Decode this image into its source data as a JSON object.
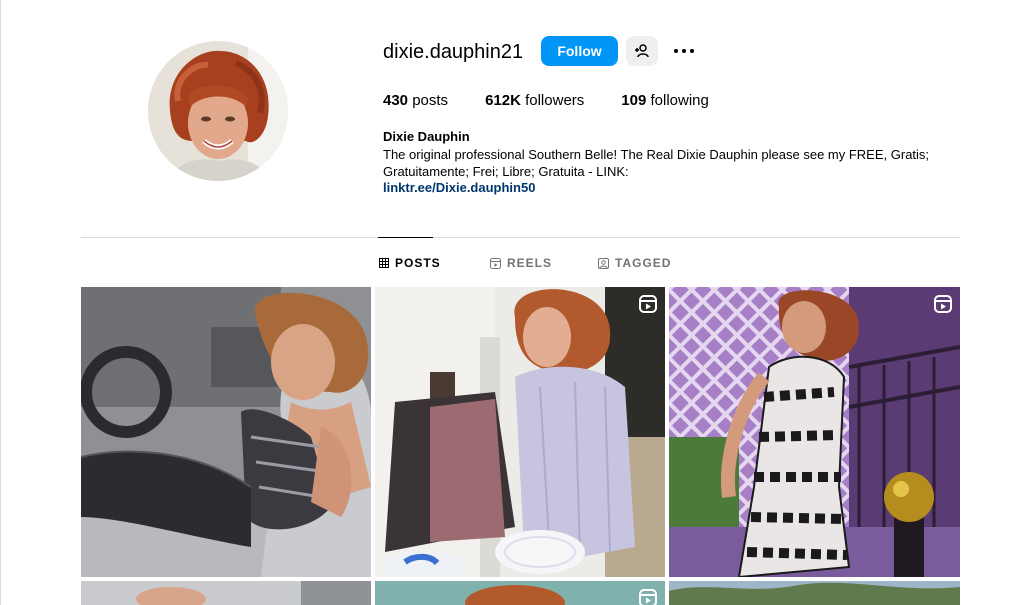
{
  "profile": {
    "username": "dixie.dauphin21",
    "full_name": "Dixie Dauphin",
    "bio": "The original professional Southern Belle! The Real Dixie Dauphin please see my FREE, Gratis; Gratuitamente; Frei; Libre; Gratuita - LINK:",
    "link": "linktr.ee/Dixie.dauphin50"
  },
  "actions": {
    "follow_label": "Follow",
    "suggest_icon": "person-add-icon",
    "more_icon": "more-options-icon"
  },
  "stats": {
    "posts_count": "430",
    "posts_label": "posts",
    "followers_count": "612K",
    "followers_label": "followers",
    "following_count": "109",
    "following_label": "following"
  },
  "tabs": [
    {
      "label": "POSTS",
      "icon": "grid-icon",
      "active": true
    },
    {
      "label": "REELS",
      "icon": "reels-icon",
      "active": false
    },
    {
      "label": "TAGGED",
      "icon": "tagged-icon",
      "active": false
    }
  ],
  "colors": {
    "accent": "#0095f6",
    "link": "#00376b",
    "muted": "#737373",
    "divider": "#dbdbdb"
  },
  "grid": [
    {
      "kind": "photo",
      "subject": "woman in car"
    },
    {
      "kind": "reel",
      "subject": "woman at grill"
    },
    {
      "kind": "reel",
      "subject": "woman in patterned dress"
    },
    {
      "kind": "photo",
      "subject": "partial"
    },
    {
      "kind": "reel",
      "subject": "partial"
    },
    {
      "kind": "photo",
      "subject": "partial trees"
    }
  ]
}
